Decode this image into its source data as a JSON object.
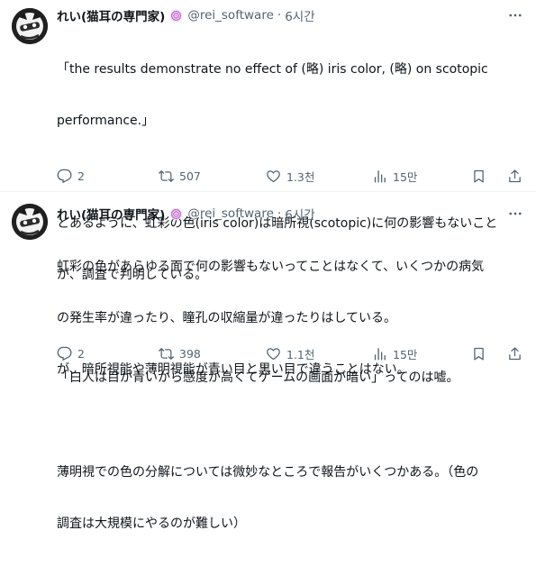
{
  "tweets": [
    {
      "author": {
        "name": "れい(猫耳の専門家)",
        "handle": "@rei_software",
        "separator": "·",
        "time": "6시간"
      },
      "lines": [
        "「the results demonstrate no effect of (略) iris color, (略) on scotopic",
        "performance.」",
        "",
        "とあるように、虹彩の色(iris color)は暗所視(scotopic)に何の影響もないこと",
        "が、調査で判明している。",
        "",
        "「白人は目が青いから感度が高くてゲームの画面が暗い」ってのは嘘。"
      ],
      "stats": {
        "replies": "2",
        "reposts": "507",
        "likes": "1.3천",
        "views": "15만"
      }
    },
    {
      "author": {
        "name": "れい(猫耳の専門家)",
        "handle": "@rei_software",
        "separator": "·",
        "time": "6시간"
      },
      "lines": [
        "虹彩の色があらゆる面で何の影響もないってことはなくて、いくつかの病気",
        "の発生率が違ったり、瞳孔の収縮量が違ったりはしている。",
        "が、暗所視能や薄明視能が青い目と黒い目で違うことはない。",
        "",
        "薄明視での色の分解については微妙なところで報告がいくつかある。（色の",
        "調査は大規模にやるのが難しい）"
      ],
      "stats": {
        "replies": "2",
        "reposts": "398",
        "likes": "1.1천",
        "views": "15만"
      }
    }
  ],
  "icons": {
    "badge": "spiral-badge-icon",
    "more": "more-icon",
    "reply": "reply-icon",
    "repost": "repost-icon",
    "like": "like-icon",
    "views": "views-icon",
    "bookmark": "bookmark-icon",
    "share": "share-icon"
  },
  "colors": {
    "text": "#0f1419",
    "secondary": "#536471",
    "badge": "#c26cc9",
    "divider": "#eff3f4"
  }
}
